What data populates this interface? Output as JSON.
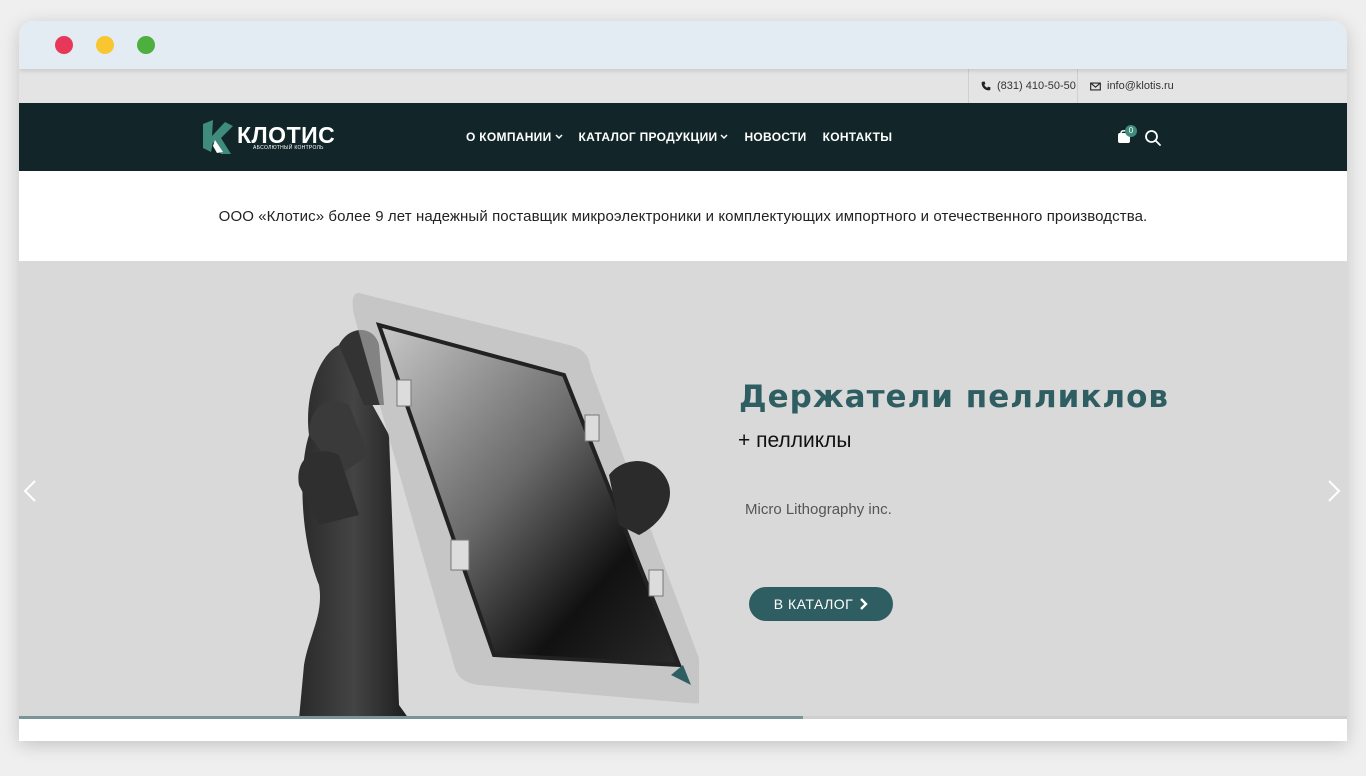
{
  "topbar": {
    "phone": "(831) 410-50-50",
    "email": "info@klotis.ru"
  },
  "logo": {
    "name": "КЛОТИС",
    "tagline": "АБСОЛЮТНЫЙ КОНТРОЛЬ"
  },
  "nav": {
    "items": [
      {
        "label": "О КОМПАНИИ",
        "dropdown": true
      },
      {
        "label": "КАТАЛОГ ПРОДУКЦИИ",
        "dropdown": true
      },
      {
        "label": "НОВОСТИ",
        "dropdown": false
      },
      {
        "label": "КОНТАКТЫ",
        "dropdown": false
      }
    ],
    "cart_count": "0",
    "icons": [
      "shopping-bag-icon",
      "search-icon"
    ]
  },
  "intro": {
    "text": "ООО «Клотис» более 9 лет надежный поставщик микроэлектроники и комплектующих импортного и отечественного производства."
  },
  "hero": {
    "title": "Держатели пелликлов",
    "subtitle": "+ пелликлы",
    "brand": "Micro Lithography inc.",
    "cta_label": "В КАТАЛОГ",
    "slide_progress": 0.59
  },
  "colors": {
    "navbar_bg": "#12262a",
    "accent": "#2f5e62",
    "badge": "#3f8c7c",
    "hero_bg": "#d9d9d9"
  }
}
